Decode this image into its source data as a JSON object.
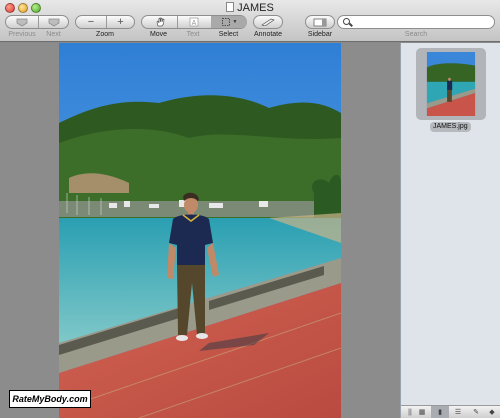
{
  "window": {
    "title": "JAMES"
  },
  "toolbar": {
    "previous_label": "Previous",
    "next_label": "Next",
    "zoom_label": "Zoom",
    "move_label": "Move",
    "text_label": "Text",
    "select_label": "Select",
    "annotate_label": "Annotate",
    "sidebar_label": "Sidebar",
    "search_label": "Search"
  },
  "search": {
    "value": ""
  },
  "thumbnail": {
    "filename": "JAMES.jpg"
  },
  "watermark": {
    "text": "RateMyBody.com"
  },
  "colors": {
    "sky": "#3a86d9",
    "water": "#2ea6b4",
    "promenade": "#c9554a",
    "shirt": "#1c2a52",
    "trousers": "#54472c"
  },
  "icons": [
    "close-icon",
    "minimize-icon",
    "zoom-icon",
    "document-icon",
    "previous-arrow-icon",
    "next-arrow-icon",
    "zoom-out-icon",
    "zoom-in-icon",
    "hand-icon",
    "text-icon",
    "select-icon",
    "annotate-icon",
    "sidebar-icon",
    "search-icon",
    "thumbnail-icon"
  ]
}
